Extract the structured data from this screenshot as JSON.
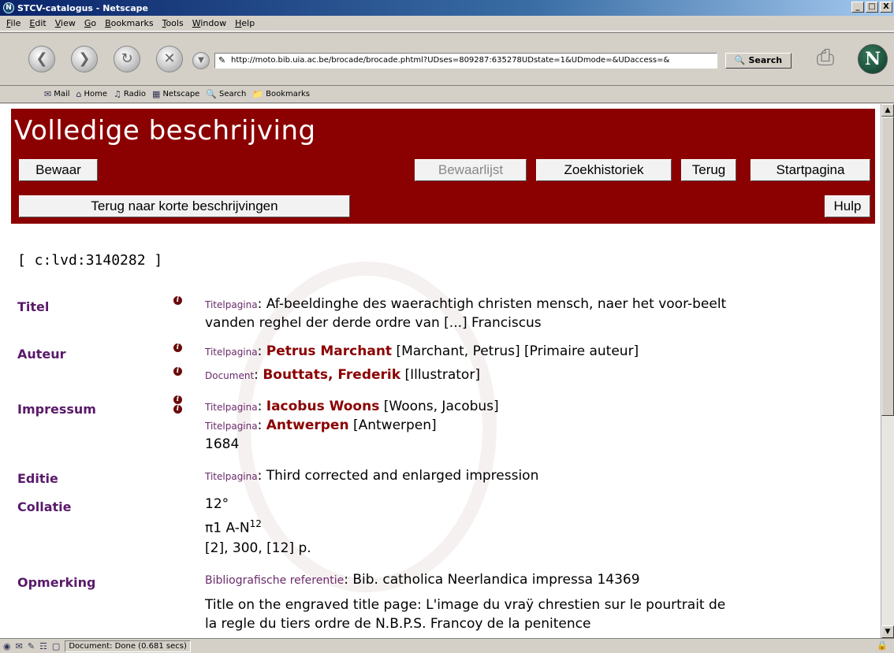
{
  "window": {
    "title": "STCV-catalogus - Netscape",
    "controls": [
      "_",
      "□",
      "X"
    ]
  },
  "menu": [
    "File",
    "Edit",
    "View",
    "Go",
    "Bookmarks",
    "Tools",
    "Window",
    "Help"
  ],
  "nav": {
    "url": "http://moto.bib.uia.ac.be/brocade/brocade.phtml?UDses=809287:635278UDstate=1&UDmode=&UDaccess=&",
    "search_label": "Search",
    "throbber": "N"
  },
  "personal_toolbar": [
    "Mail",
    "Home",
    "Radio",
    "Netscape",
    "Search",
    "Bookmarks"
  ],
  "page": {
    "heading": "Volledige beschrijving",
    "buttons": {
      "bewaar": "Bewaar",
      "bewaarlijst": "Bewaarlijst",
      "zoekhistoriek": "Zoekhistoriek",
      "terug": "Terug",
      "startpagina": "Startpagina",
      "terug_kort": "Terug naar korte beschrijvingen",
      "hulp": "Hulp"
    },
    "record_id": "[ c:lvd:3140282 ]",
    "fields": {
      "titel": {
        "label": "Titel",
        "source": "Titelpagina",
        "line1": "Af-beeldinghe des waerachtigh christen mensch, naer het voor-beelt",
        "line2": "vanden reghel der derde ordre van [...] Franciscus"
      },
      "auteur": {
        "label": "Auteur",
        "rows": [
          {
            "source": "Titelpagina",
            "name": "Petrus Marchant",
            "extra": " [Marchant, Petrus] [Primaire auteur]"
          },
          {
            "source": "Document",
            "name": "Bouttats, Frederik",
            "extra": " [Illustrator]"
          }
        ]
      },
      "impressum": {
        "label": "Impressum",
        "rows": [
          {
            "source": "Titelpagina",
            "name": "Iacobus Woons",
            "extra": " [Woons, Jacobus]"
          },
          {
            "source": "Titelpagina",
            "name": "Antwerpen",
            "extra": " [Antwerpen]"
          }
        ],
        "year": "1684"
      },
      "editie": {
        "label": "Editie",
        "source": "Titelpagina",
        "value": "Third corrected and enlarged impression"
      },
      "collatie": {
        "label": "Collatie",
        "format": "12°",
        "signature": "π1 A-N",
        "signature_sup": "12",
        "pages": "[2], 300, [12] p."
      },
      "opmerking": {
        "label": "Opmerking",
        "source": "Bibliografische referentie",
        "value": "Bib. catholica Neerlandica impressa 14369",
        "note1": "Title on the engraved title page: L'image du vraÿ chrestien sur le pourtrait de",
        "note2": "la regle du tiers ordre de N.B.P.S. Francoy de la penitence"
      }
    }
  },
  "status": {
    "text": "Document: Done (0.681 secs)"
  },
  "colors": {
    "header_bg": "#8b0000",
    "label": "#5a1a6a",
    "name": "#8b0000"
  }
}
